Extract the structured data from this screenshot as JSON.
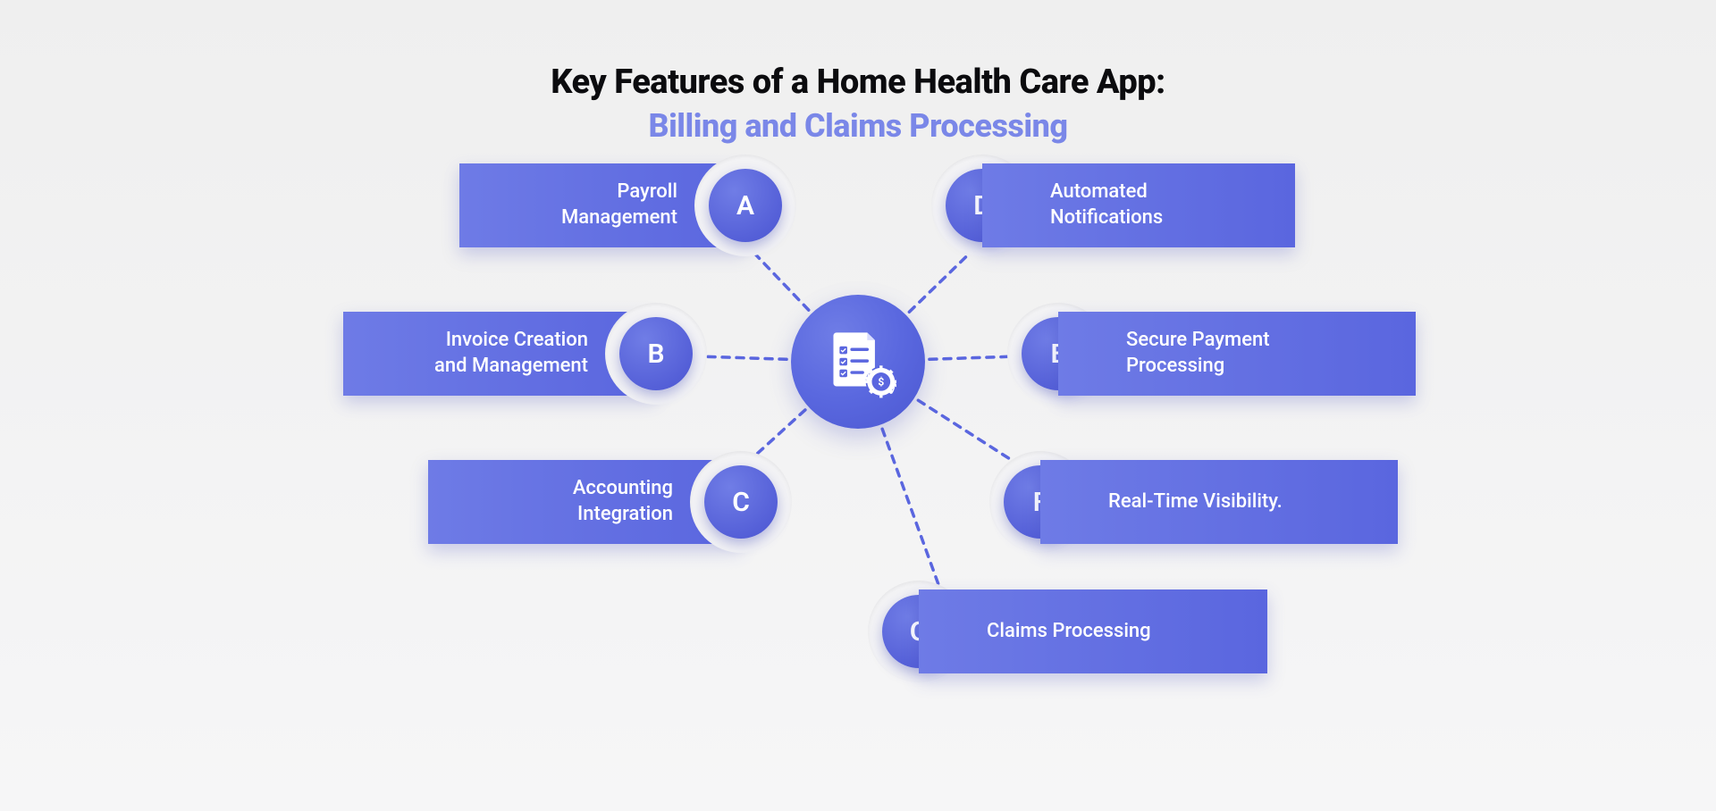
{
  "title": {
    "line1": "Key Features of a Home Health Care App:",
    "line2": "Billing and Claims Processing"
  },
  "hub": {
    "icon": "billing-document-gear-icon"
  },
  "features": [
    {
      "id": "A",
      "side": "left",
      "label": "Payroll\nManagement"
    },
    {
      "id": "B",
      "side": "left",
      "label": "Invoice Creation\nand Management"
    },
    {
      "id": "C",
      "side": "left",
      "label": "Accounting\nIntegration"
    },
    {
      "id": "D",
      "side": "right",
      "label": "Automated\nNotifications"
    },
    {
      "id": "E",
      "side": "right",
      "label": "Secure Payment\nProcessing"
    },
    {
      "id": "F",
      "side": "right",
      "label": "Real-Time Visibility."
    },
    {
      "id": "G",
      "side": "right",
      "label": "Claims Processing"
    }
  ],
  "colors": {
    "accent": "#5a66df",
    "accent_light": "#7a87e8",
    "text": "#0b0b0e"
  }
}
